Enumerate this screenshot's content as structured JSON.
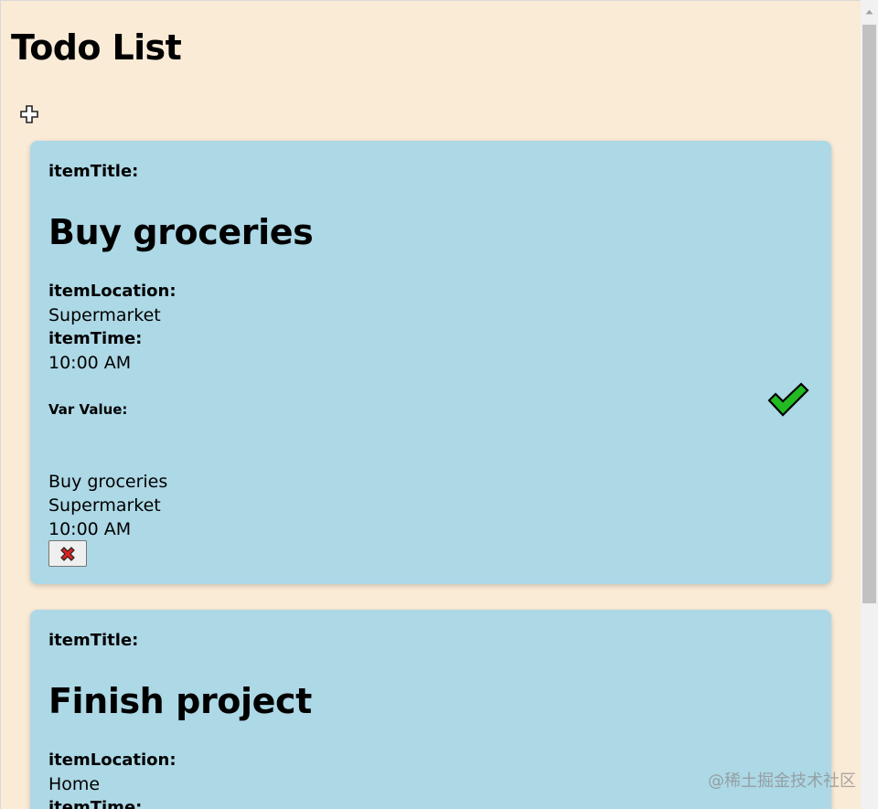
{
  "page": {
    "title": "Todo List",
    "background_color": "#faebd7",
    "card_color": "#add8e6"
  },
  "toolbar": {
    "add_icon": "plus-icon"
  },
  "labels": {
    "item_title": "itemTitle:",
    "item_location": "itemLocation:",
    "item_time": "itemTime:",
    "var_value": "Var Value:"
  },
  "todos": [
    {
      "title": "Buy groceries",
      "location": "Supermarket",
      "time": "10:00 AM",
      "var_title": "Buy groceries",
      "var_location": "Supermarket",
      "var_time": "10:00 AM",
      "complete_icon": "checkmark-icon",
      "complete_color": "#22bb22",
      "delete_icon": "cross-icon",
      "delete_color": "#dd2222"
    },
    {
      "title": "Finish project",
      "location": "Home",
      "time": ""
    }
  ],
  "watermark": "@稀土掘金技术社区"
}
